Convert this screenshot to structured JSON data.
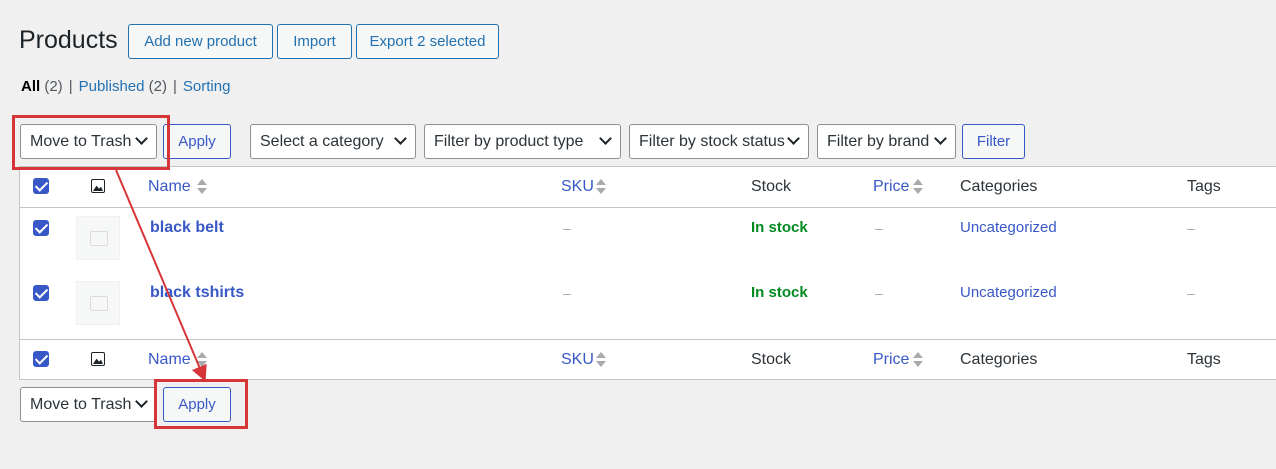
{
  "header": {
    "title": "Products",
    "add_new_label": "Add new product",
    "import_label": "Import",
    "export_label": "Export 2 selected"
  },
  "views": {
    "all_label": "All",
    "all_count": "(2)",
    "published_label": "Published",
    "published_count": "(2)",
    "sorting_label": "Sorting",
    "separator": "|"
  },
  "top_actions": {
    "bulk_action_selected": "Move to Trash",
    "apply_label": "Apply",
    "category_filter": "Select a category",
    "product_type_filter": "Filter by product type",
    "stock_status_filter": "Filter by stock status",
    "brand_filter": "Filter by brand",
    "filter_label": "Filter"
  },
  "table": {
    "columns": {
      "name": "Name",
      "sku": "SKU",
      "stock": "Stock",
      "price": "Price",
      "categories": "Categories",
      "tags": "Tags"
    },
    "rows": [
      {
        "name": "black belt",
        "sku": "–",
        "stock": "In stock",
        "price": "–",
        "categories": "Uncategorized",
        "tags": "–"
      },
      {
        "name": "black tshirts",
        "sku": "–",
        "stock": "In stock",
        "price": "–",
        "categories": "Uncategorized",
        "tags": "–"
      }
    ]
  },
  "bottom_actions": {
    "bulk_action_selected": "Move to Trash",
    "apply_label": "Apply"
  },
  "annotation": {
    "highlight_color": "#d63638"
  }
}
